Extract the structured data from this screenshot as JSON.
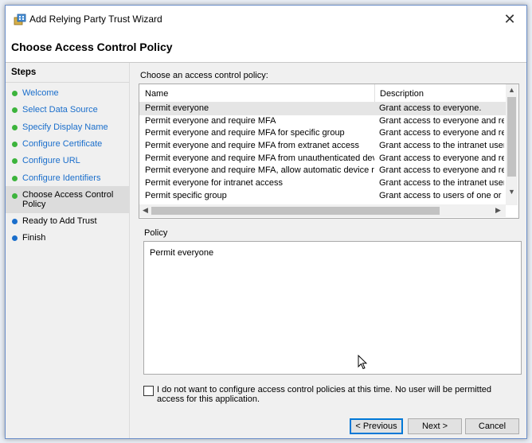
{
  "window": {
    "title": "Add Relying Party Trust Wizard",
    "close": "✕"
  },
  "page": {
    "heading": "Choose Access Control Policy"
  },
  "sidebar": {
    "title": "Steps",
    "items": [
      {
        "label": "Welcome",
        "state": "done"
      },
      {
        "label": "Select Data Source",
        "state": "done"
      },
      {
        "label": "Specify Display Name",
        "state": "done"
      },
      {
        "label": "Configure Certificate",
        "state": "done"
      },
      {
        "label": "Configure URL",
        "state": "done"
      },
      {
        "label": "Configure Identifiers",
        "state": "done"
      },
      {
        "label": "Choose Access Control Policy",
        "state": "current"
      },
      {
        "label": "Ready to Add Trust",
        "state": "todo"
      },
      {
        "label": "Finish",
        "state": "todo"
      }
    ],
    "colors": {
      "done": "#3cb43c",
      "current": "#3cb43c",
      "todo": "#1a6ecb"
    }
  },
  "policy_list": {
    "label": "Choose an access control policy:",
    "columns": [
      "Name",
      "Description"
    ],
    "rows": [
      {
        "name": "Permit everyone",
        "desc": "Grant access to everyone.",
        "selected": true
      },
      {
        "name": "Permit everyone and require MFA",
        "desc": "Grant access to everyone and requir"
      },
      {
        "name": "Permit everyone and require MFA for specific group",
        "desc": "Grant access to everyone and requir"
      },
      {
        "name": "Permit everyone and require MFA from extranet access",
        "desc": "Grant access to the intranet users an"
      },
      {
        "name": "Permit everyone and require MFA from unauthenticated devices",
        "desc": "Grant access to everyone and requir"
      },
      {
        "name": "Permit everyone and require MFA, allow automatic device registr...",
        "desc": "Grant access to everyone and requir"
      },
      {
        "name": "Permit everyone for intranet access",
        "desc": "Grant access to the intranet users."
      },
      {
        "name": "Permit specific group",
        "desc": "Grant access to users of one or more"
      }
    ],
    "scroll_up": "▲",
    "scroll_down": "▼",
    "scroll_left": "◀",
    "scroll_right": "▶"
  },
  "policy_detail": {
    "label": "Policy",
    "text": "Permit everyone"
  },
  "opt_out": {
    "label": "I do not want to configure access control policies at this time. No user will be permitted access for this application.",
    "checked": false
  },
  "buttons": {
    "previous": "< Previous",
    "next": "Next >",
    "cancel": "Cancel"
  }
}
